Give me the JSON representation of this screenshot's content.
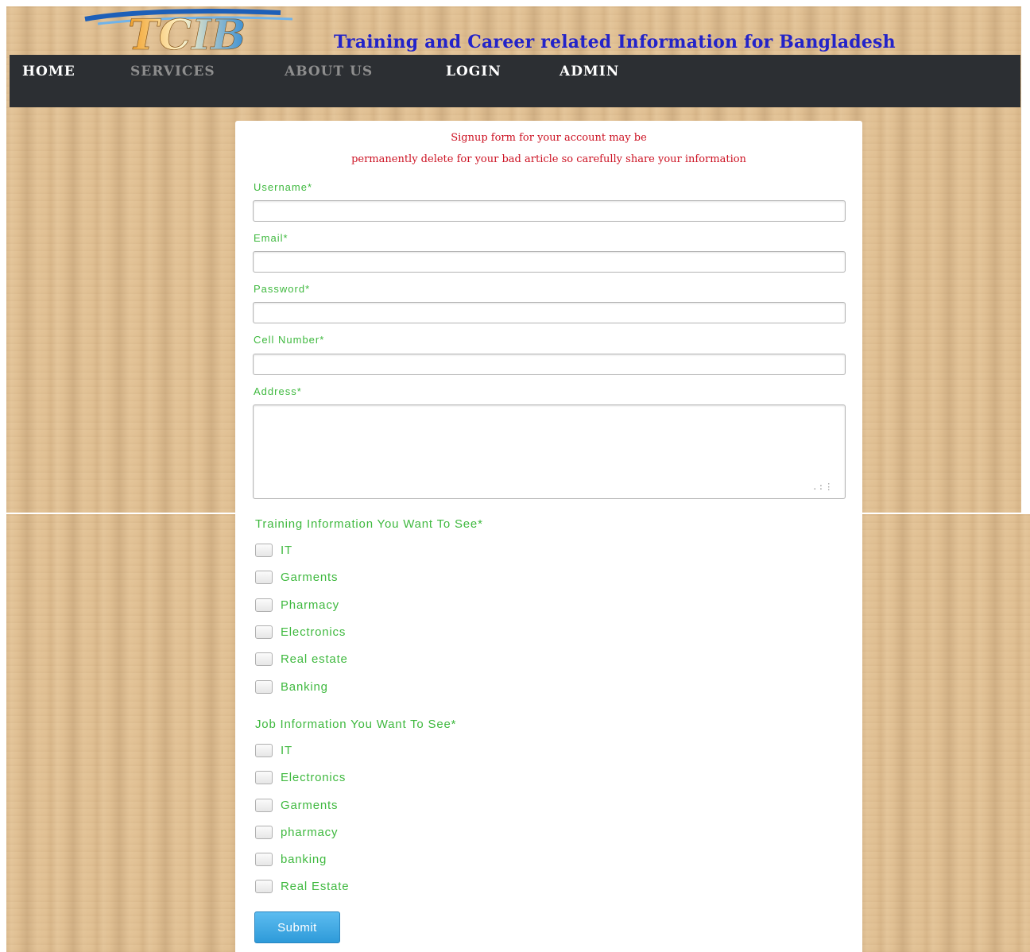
{
  "header": {
    "logo_text": "TCIB",
    "site_title": "Training and Career related Information for Bangladesh"
  },
  "nav": {
    "home": "HOME",
    "services": "SERVICES",
    "about": "ABOUT US",
    "login": "LOGIN",
    "admin": "ADMIN"
  },
  "form": {
    "notice_line1": "Signup form for your account may be",
    "notice_line2": "permanently delete for your bad article so carefully share your information",
    "username_label": "Username*",
    "email_label": "Email*",
    "password_label": "Password*",
    "cell_label": "Cell Number*",
    "address_label": "Address*",
    "username_value": "",
    "email_value": "",
    "password_value": "",
    "cell_value": "",
    "address_value": "",
    "training_title": "Training Information You Want To See*",
    "training_options": [
      "IT",
      "Garments",
      "Pharmacy",
      "Electronics",
      "Real estate",
      "Banking"
    ],
    "job_title": "Job Information You Want To See*",
    "job_options": [
      "IT",
      "Electronics",
      "Garments",
      "pharmacy",
      "banking",
      "Real Estate"
    ],
    "submit_label": "Submit"
  },
  "colors": {
    "label_green": "#3fb93f",
    "notice_red": "#cc1122",
    "title_blue": "#2323c8",
    "navbar_bg": "#2c2f33",
    "button_blue": "#2e9ad9"
  },
  "icons": {
    "resize": "resize-grip-icon",
    "logo": "tcib-logo-icon"
  }
}
